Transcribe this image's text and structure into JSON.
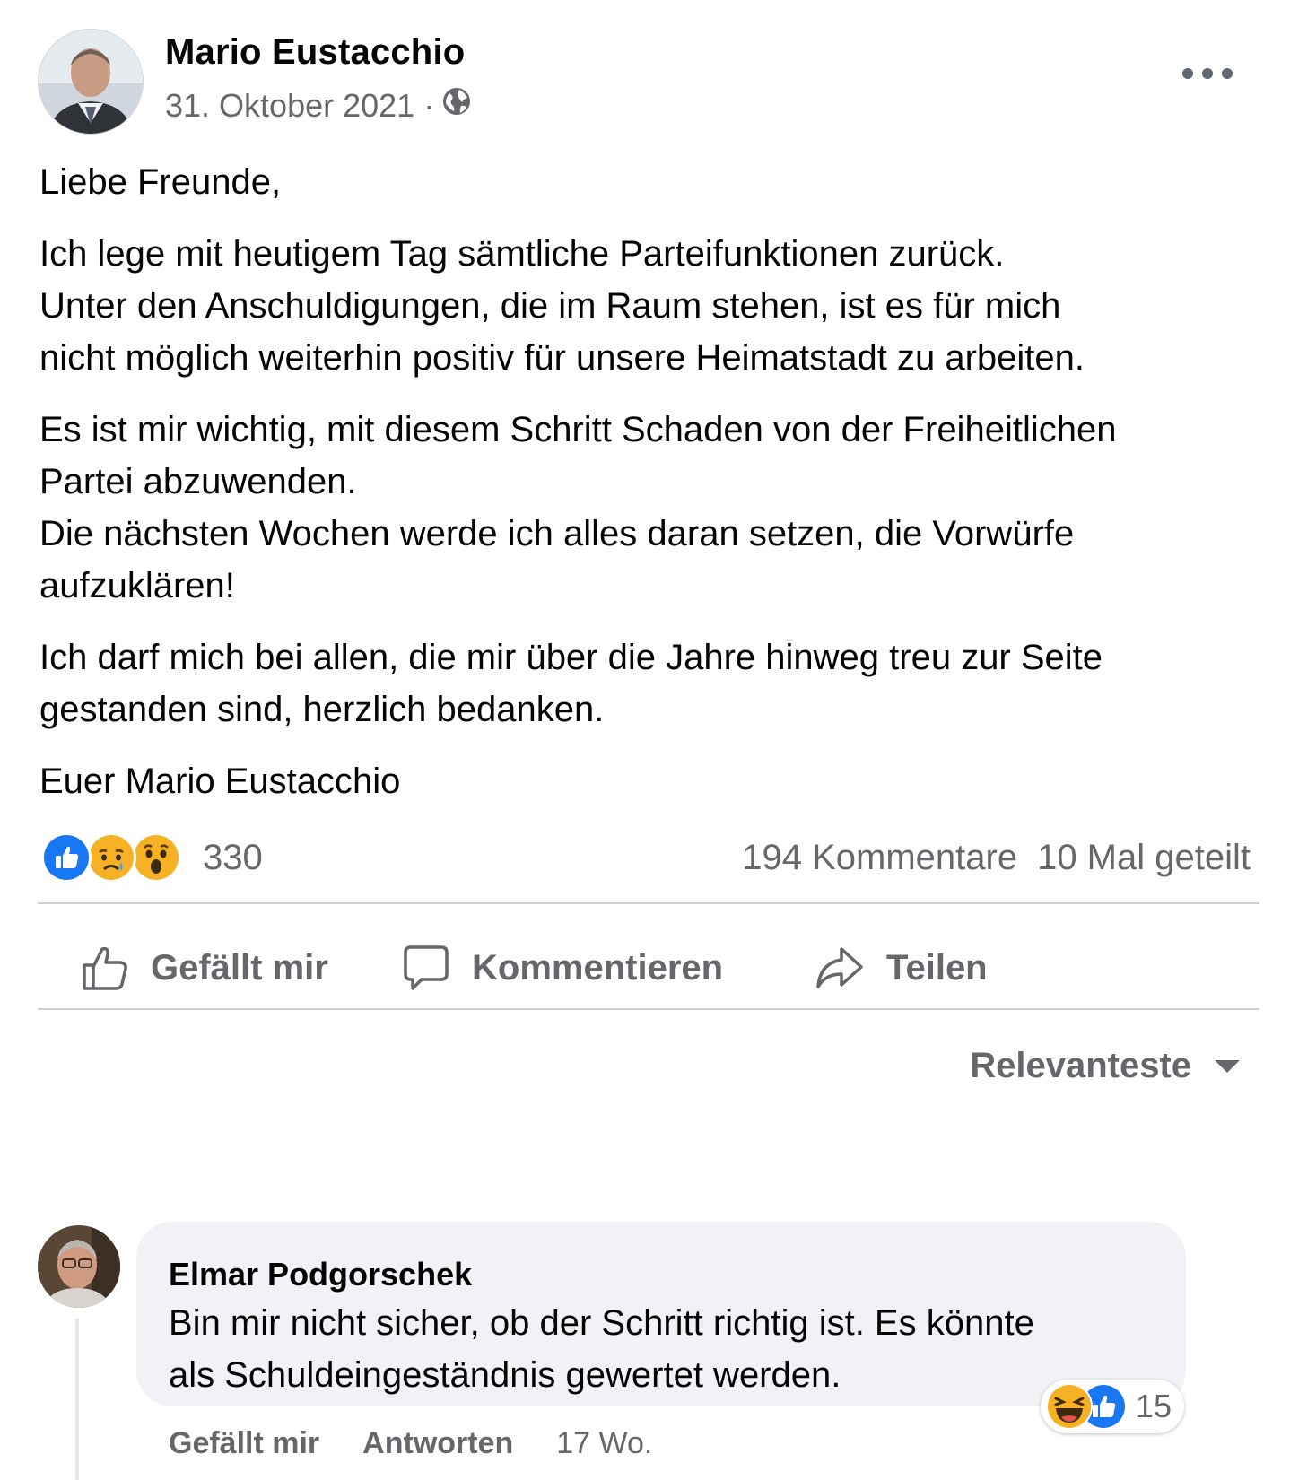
{
  "post": {
    "author": "Mario Eustacchio",
    "date": "31. Oktober 2021",
    "separator": "·",
    "paragraphs": [
      [
        "Liebe Freunde,"
      ],
      [
        "Ich lege mit heutigem Tag sämtliche Parteifunktionen zurück.",
        "Unter den Anschuldigungen, die im Raum stehen, ist es für mich",
        "nicht möglich weiterhin positiv für unsere Heimatstadt zu arbeiten."
      ],
      [
        "Es ist mir wichtig, mit diesem Schritt Schaden von der Freiheitlichen",
        "Partei abzuwenden.",
        "Die nächsten Wochen werde ich alles daran setzen, die Vorwürfe",
        "aufzuklären!"
      ],
      [
        "Ich darf mich bei allen, die mir über die Jahre hinweg treu zur Seite",
        "gestanden sind, herzlich bedanken."
      ],
      [
        "Euer Mario Eustacchio"
      ]
    ],
    "reactions": {
      "icons": [
        "like-icon",
        "sad-icon",
        "wow-icon"
      ],
      "count": "330"
    },
    "comments_count": "194 Kommentare",
    "shares_count": "10 Mal geteilt"
  },
  "actions": {
    "like": "Gefällt mir",
    "comment": "Kommentieren",
    "share": "Teilen"
  },
  "sort": {
    "label": "Relevanteste"
  },
  "comment": {
    "author": "Elmar Podgorschek",
    "lines": [
      "Bin mir nicht sicher, ob der Schritt richtig ist. Es könnte",
      "als Schuldeingeständnis gewertet werden."
    ],
    "reactions": {
      "icons": [
        "haha-icon",
        "like-icon"
      ],
      "count": "15"
    },
    "like_label": "Gefällt mir",
    "reply_label": "Antworten",
    "time": "17 Wo."
  },
  "colors": {
    "text": "#050505",
    "secondary": "#65676b",
    "like_blue": "#1877f2",
    "reaction_yellow": "#f7b125",
    "bubble_bg": "#f0f2f5",
    "divider": "#ced0d4"
  }
}
